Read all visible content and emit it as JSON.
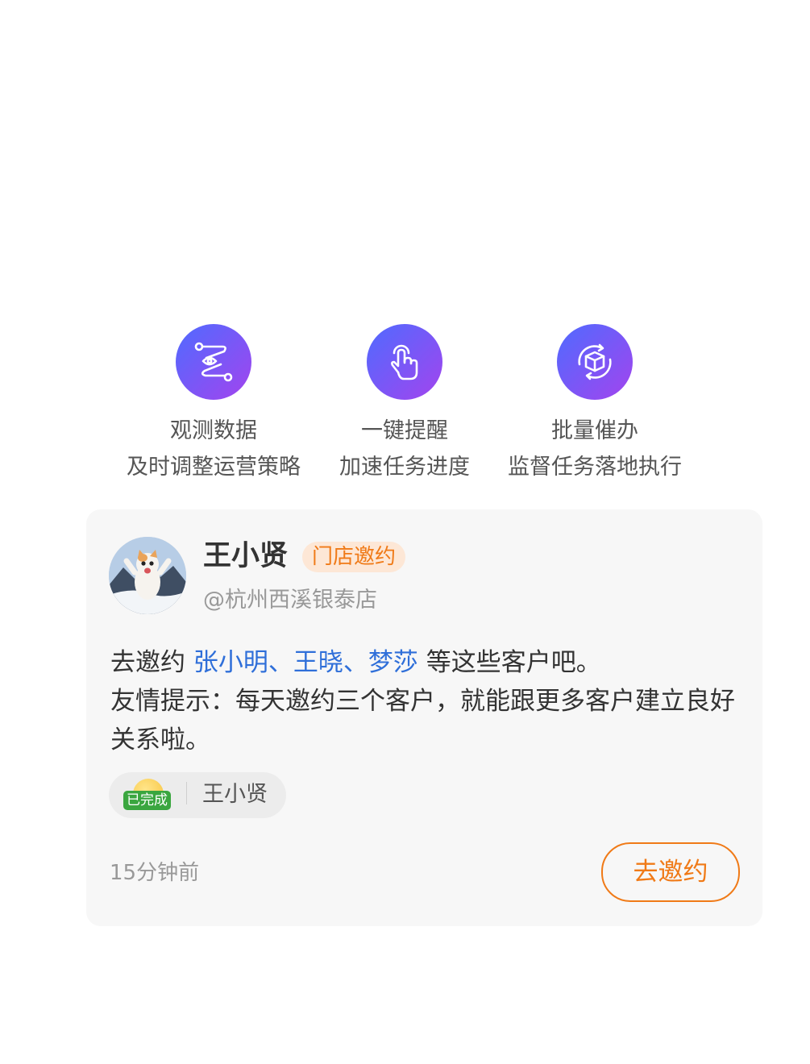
{
  "features": [
    {
      "icon": "data-observe-icon",
      "title": "观测数据",
      "desc": "及时调整运营策略"
    },
    {
      "icon": "tap-hand-icon",
      "title": "一键提醒",
      "desc": "加速任务进度"
    },
    {
      "icon": "batch-box-icon",
      "title": "批量催办",
      "desc": "监督任务落地执行"
    }
  ],
  "card": {
    "avatar_icon": "cat-avatar",
    "name": "王小贤",
    "tag": "门店邀约",
    "store": "@杭州西溪银泰店",
    "msg_prefix": "去邀约 ",
    "msg_highlight": "张小明、王晓、梦莎",
    "msg_suffix": " 等这些客户吧。",
    "msg_tip": "友情提示：每天邀约三个客户，就能跟更多客户建立良好关系啦。",
    "status_badge": "已完成",
    "status_person": "王小贤",
    "time": "15分钟前",
    "action": "去邀约"
  },
  "colors": {
    "accent": "#f07a17",
    "highlight": "#2f6fd9",
    "icon_gradient_start": "#4f6bff",
    "icon_gradient_end": "#a344ee"
  }
}
